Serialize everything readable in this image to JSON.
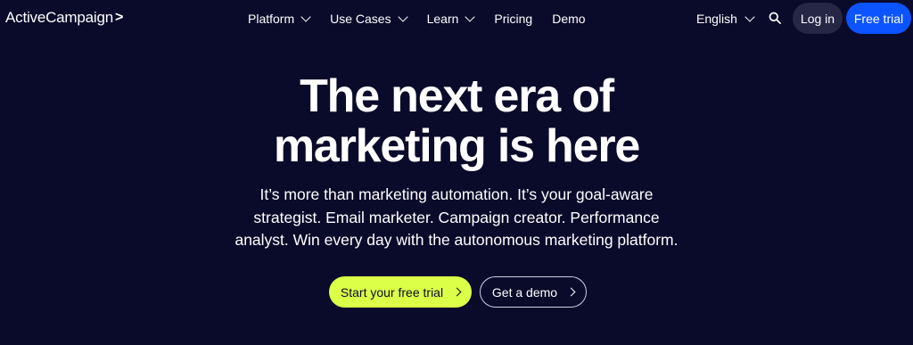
{
  "header": {
    "logo_text": "ActiveCampaign",
    "logo_mark": ">",
    "nav": {
      "platform": "Platform",
      "use_cases": "Use Cases",
      "learn": "Learn",
      "pricing": "Pricing",
      "demo": "Demo"
    },
    "language": "English",
    "login_label": "Log in",
    "free_trial_label": "Free trial"
  },
  "hero": {
    "title_line1": "The next era of",
    "title_line2": "marketing is here",
    "subtitle_line1": "It’s more than marketing automation. It’s your goal-aware",
    "subtitle_line2": "strategist. Email marketer. Campaign creator. Performance",
    "subtitle_line3": "analyst. Win every day with the autonomous marketing platform.",
    "primary_cta": "Start your free trial",
    "secondary_cta": "Get a demo"
  },
  "icons": {
    "search": "search-icon",
    "chevron_down": "chevron-down-icon",
    "chevron_right": "chevron-right-icon"
  },
  "colors": {
    "background": "#0a0a2a",
    "login_bg": "#262647",
    "trial_bg": "#0b54ff",
    "cta_primary_bg": "#dcff48",
    "text": "#ffffff"
  }
}
